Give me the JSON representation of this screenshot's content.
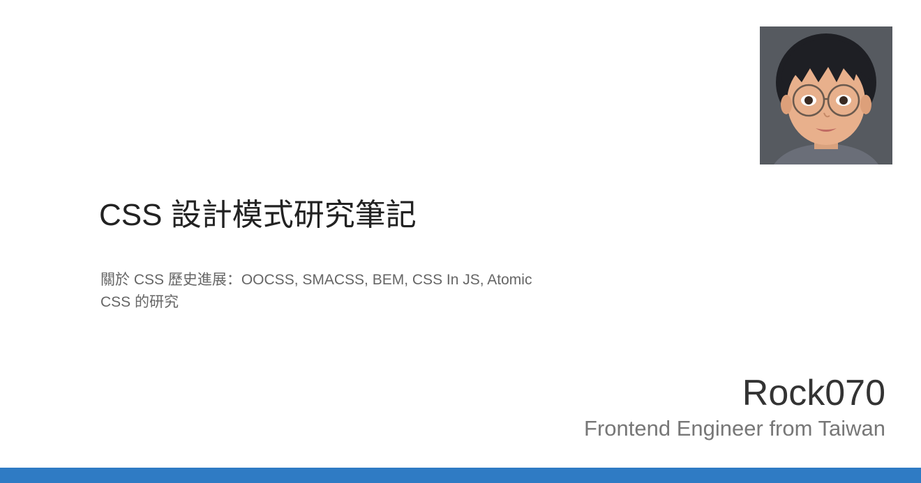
{
  "post": {
    "title": "CSS 設計模式研究筆記",
    "description": "關於 CSS 歷史進展：OOCSS, SMACSS, BEM, CSS In JS, Atomic CSS 的研究"
  },
  "author": {
    "name": "Rock070",
    "role": "Frontend Engineer from Taiwan",
    "avatar_icon": "avatar-portrait-icon"
  },
  "colors": {
    "footer_bar": "#2f7bc4",
    "title": "#222222",
    "description": "#666666"
  }
}
